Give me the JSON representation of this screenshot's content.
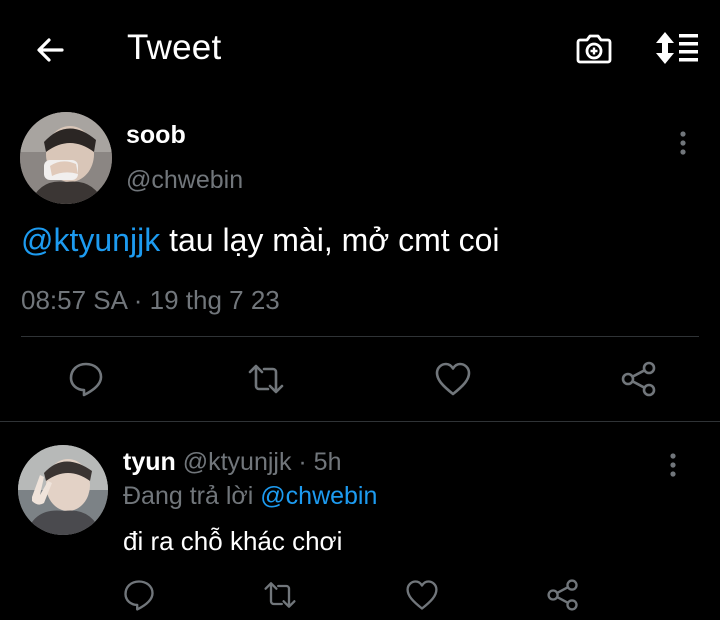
{
  "header": {
    "title": "Tweet",
    "back_icon": "arrow-left-icon",
    "camera_icon": "camera-plus-icon",
    "sort_icon": "sort-list-icon"
  },
  "tweet": {
    "display_name": "soob",
    "handle": "@chwebin",
    "mention": "@ktyunjjk",
    "text": " tau lạy mài, mở cmt coi",
    "timestamp": "08:57 SA · 19 thg 7 23",
    "actions": [
      "reply-icon",
      "retweet-icon",
      "like-icon",
      "share-icon"
    ]
  },
  "reply": {
    "display_name": "tyun",
    "handle_time": " @ktyunjjk · 5h",
    "replying_prefix": "Đang trả lời ",
    "replying_to": "@chwebin",
    "text": "đi ra chỗ khác chơi",
    "actions": [
      "reply-icon",
      "retweet-icon",
      "like-icon",
      "share-icon"
    ]
  },
  "colors": {
    "background": "#000000",
    "text": "#ffffff",
    "secondary": "#71767b",
    "accent": "#1d9bf0",
    "divider": "#2f3336"
  }
}
